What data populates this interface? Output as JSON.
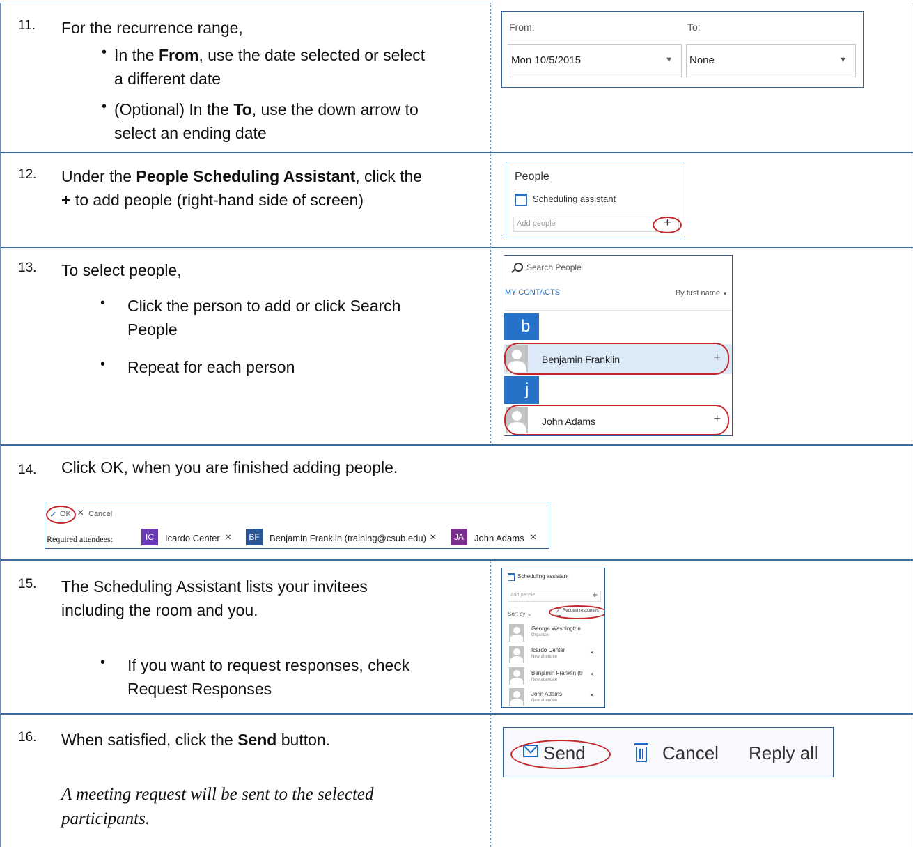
{
  "steps": [
    {
      "num": "11.",
      "intro": "For the recurrence range,",
      "b1_pre": "In the ",
      "b1_bold": "From",
      "b1_post": ", use the date selected or select",
      "b1_line2": "a different date",
      "b2_pre": "(Optional) In the ",
      "b2_bold": "To",
      "b2_post": ", use the down arrow to",
      "b2_line2": "select an ending date"
    },
    {
      "num": "12.",
      "l1_pre": "Under the ",
      "l1_bold": "People Scheduling Assistant",
      "l1_post": ", click the",
      "l2_bold": "+",
      "l2_post": " to add people (right-hand side of screen)"
    },
    {
      "num": "13.",
      "intro": "To select people,",
      "b1_line1": "Click the person to add or click Search",
      "b1_line2": "People",
      "b2": "Repeat for each person"
    },
    {
      "num": "14.",
      "text": "Click OK, when you are finished adding people."
    },
    {
      "num": "15.",
      "l1": "The Scheduling Assistant lists your invitees",
      "l2": "including the room and you.",
      "b1_line1": "If you want to request responses, check",
      "b1_line2": "Request Responses"
    },
    {
      "num": "16.",
      "l1_pre": "When satisfied, click the ",
      "l1_bold": "Send",
      "l1_post": " button.",
      "note_line1": "A meeting request will be sent to the selected",
      "note_line2": "participants."
    }
  ],
  "shot_recurrence": {
    "from_label": "From:",
    "to_label": "To:",
    "from_value": "Mon 10/5/2015",
    "to_value": "None",
    "arrow": "▼"
  },
  "shot_people": {
    "title": "People",
    "assistant": "Scheduling assistant",
    "placeholder": "Add people",
    "plus": "+"
  },
  "shot_contacts": {
    "search": "Search People",
    "tab": "MY CONTACTS",
    "sort": "By first name",
    "groups": [
      {
        "letter": "b",
        "person": "Benjamin Franklin"
      },
      {
        "letter": "j",
        "person": "John Adams"
      }
    ],
    "plus": "+"
  },
  "shot_ok": {
    "ok": "OK",
    "cancel": "Cancel",
    "label": "Required attendees:",
    "attendees": [
      {
        "initials": "IC",
        "name": "Icardo Center",
        "color": "#6a3ab2"
      },
      {
        "initials": "BF",
        "name": "Benjamin Franklin (training@csub.edu)",
        "color": "#2a5596"
      },
      {
        "initials": "JA",
        "name": "John Adams",
        "color": "#7a2f8e"
      }
    ],
    "x": "×"
  },
  "shot_assistant": {
    "title": "Scheduling assistant",
    "placeholder": "Add people",
    "plus": "+",
    "sort": "Sort by",
    "request": "Request responses",
    "people": [
      {
        "name": "George Washington",
        "role": "Organizer",
        "x": ""
      },
      {
        "name": "Icardo Center",
        "role": "New attendee",
        "x": "×"
      },
      {
        "name": "Benjamin Franklin (tr",
        "role": "New attendee",
        "x": "×"
      },
      {
        "name": "John Adams",
        "role": "New attendee",
        "x": "×"
      }
    ]
  },
  "shot_send": {
    "send": "Send",
    "cancel": "Cancel",
    "reply_all": "Reply all"
  }
}
